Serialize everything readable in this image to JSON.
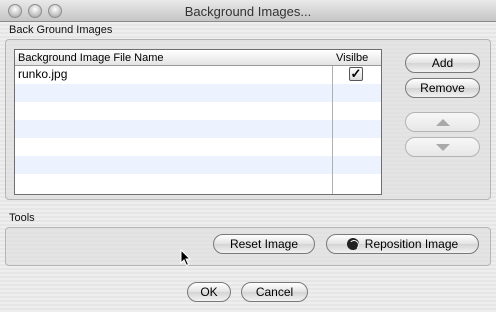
{
  "window": {
    "title": "Background Images..."
  },
  "background_section": {
    "label": "Back Ground Images",
    "table": {
      "columns": [
        "Background Image File Name",
        "Visilbe"
      ],
      "rows": [
        {
          "file_name": "runko.jpg",
          "visible": true
        }
      ]
    },
    "buttons": {
      "add": "Add",
      "remove": "Remove"
    }
  },
  "tools_section": {
    "label": "Tools",
    "buttons": {
      "reset_image": "Reset Image",
      "reposition_image": "Reposition Image"
    }
  },
  "dialog_buttons": {
    "ok": "OK",
    "cancel": "Cancel"
  },
  "icons": {
    "checkbox_checked": "✓",
    "move_up": "triangle-up-icon",
    "move_down": "triangle-down-icon",
    "reposition": "globe-icon"
  }
}
